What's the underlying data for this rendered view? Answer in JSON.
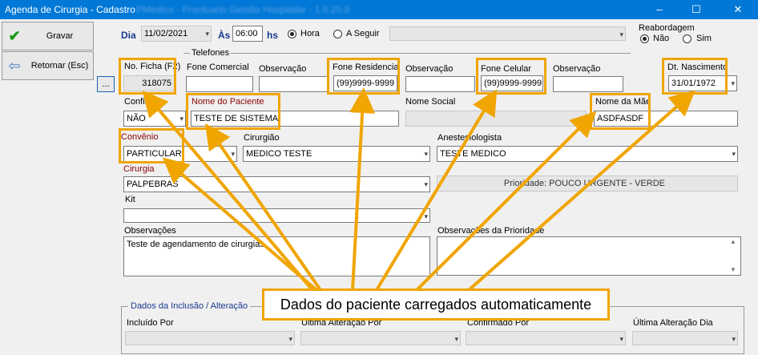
{
  "window": {
    "title": "Agenda de Cirurgia - Cadastro",
    "blurred_title": "PMedico - Prontuario Gestão Hospitalar - 1.0.25.0",
    "minimize": "–",
    "maximize": "☐",
    "close": "✕"
  },
  "toolbar": {
    "save_label": "Gravar",
    "back_label": "Retornar (Esc)"
  },
  "schedule": {
    "dia_label": "Dia",
    "date_value": "11/02/2021",
    "as_label": "Às",
    "time_value": "06:00",
    "hs_label": "hs",
    "hora_label": "Hora",
    "a_seguir_label": "A Seguir"
  },
  "reabordagem": {
    "label": "Reabordagem",
    "nao_label": "Não",
    "sim_label": "Sim"
  },
  "telefones": {
    "legend": "Telefones"
  },
  "labels": {
    "no_ficha": "No. Ficha (F2)",
    "fone_comercial": "Fone Comercial",
    "observacao": "Observação",
    "fone_residencia": "Fone Residencia",
    "fone_celular": "Fone Celular",
    "dt_nascimento": "Dt. Nascimento",
    "confirmar": "Confirmar",
    "nome_paciente": "Nome do Paciente",
    "nome_social": "Nome Social",
    "nome_mae": "Nome da Mãe",
    "convenio": "Convênio",
    "cirurgiao": "Cirurgião",
    "anestesiologista": "Anestesiologista",
    "cirurgia": "Cirurgia",
    "kit": "Kit",
    "observacoes": "Observações",
    "observacoes_prioridade": "Observações da Prioridade"
  },
  "values": {
    "ficha_button": "...",
    "no_ficha": "318075",
    "fone_comercial": "",
    "obs1": "",
    "fone_residencia": "(99)9999-9999",
    "obs2": "",
    "fone_celular": "(99)9999-9999",
    "obs3": "",
    "dt_nascimento": "31/01/1972",
    "confirmar": "NÃO",
    "nome_paciente": "TESTE DE SISTEMA",
    "nome_social": "",
    "nome_mae": "ASDFASDF",
    "convenio": "PARTICULAR",
    "cirurgiao": "MEDICO TESTE",
    "anestesiologista": "TESTE MEDICO",
    "cirurgia": "PALPEBRAS",
    "prioridade": "Prioridade: POUCO URGENTE - VERDE",
    "kit": "",
    "observacoes": "Teste de agendamento de cirurgias",
    "observacoes_prioridade": ""
  },
  "inclusao": {
    "legend": "Dados da Inclusão / Alteração",
    "incluido_por": "Incluído Por",
    "ultima_alteracao_por": "Última Alteração Por",
    "confirmado_por": "Confirmado Por",
    "ultima_alteracao_dia": "Última Alteração Dia"
  },
  "annotation": {
    "text": "Dados do paciente carregados automaticamente"
  },
  "colors": {
    "highlight": "#f0a500",
    "titlebar": "#0078d7"
  }
}
